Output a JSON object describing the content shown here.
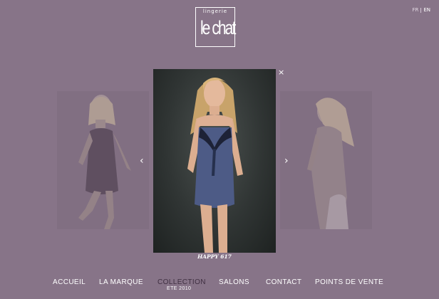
{
  "brand": {
    "small_text": "lingerie",
    "name": "le chat"
  },
  "language": {
    "options": [
      "FR",
      "EN"
    ],
    "active": "EN"
  },
  "gallery": {
    "caption": "HAPPY 617",
    "prev_icon": "chevron-left-icon",
    "next_icon": "chevron-right-icon",
    "close_label": "×"
  },
  "nav": {
    "items": [
      "ACCUEIL",
      "LA MARQUE",
      "COLLECTION",
      "SALONS",
      "CONTACT",
      "POINTS DE VENTE"
    ],
    "active_sub": "ETE 2010"
  },
  "colors": {
    "background": "#877488",
    "active_nav": "#3f2f41"
  }
}
